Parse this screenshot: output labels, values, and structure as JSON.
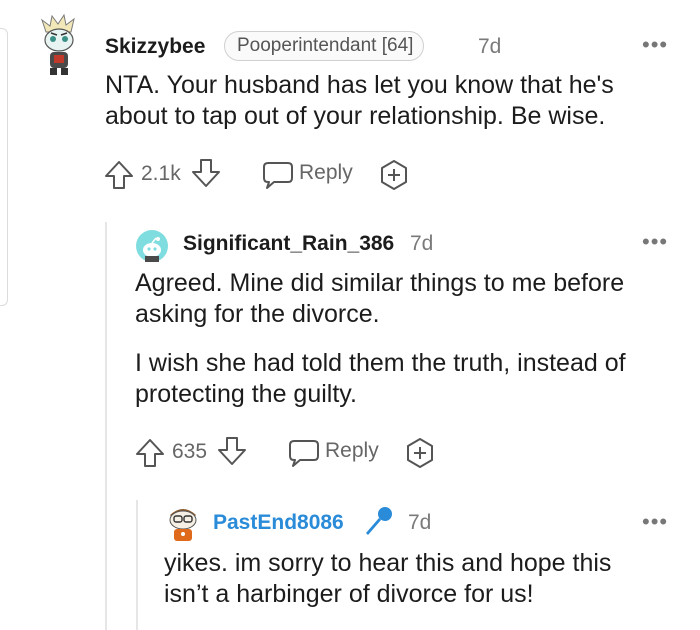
{
  "comments": [
    {
      "username": "Skizzybee",
      "flair": "Pooperintendant [64]",
      "time": "7d",
      "avatar": "snoo-avatar-skizzybee",
      "paragraphs": [
        "NTA. Your husband has let you know that he's",
        "about to tap out of your relationship. Be wise."
      ],
      "votes": "2.1k",
      "reply_label": "Reply"
    },
    {
      "username": "Significant_Rain_386",
      "time": "7d",
      "avatar": "default-snoo-avatar",
      "paragraphs": [
        "Agreed. Mine did similar things to me before",
        "asking for the divorce.",
        "I wish she had told them the truth, instead of",
        "protecting the guilty."
      ],
      "votes": "635",
      "reply_label": "Reply"
    },
    {
      "username": "PastEnd8086",
      "time": "7d",
      "avatar": "snoo-avatar-pastend",
      "op_badge_icon": "microphone-icon",
      "paragraphs": [
        "yikes. im sorry to hear this and hope this",
        "isn’t a harbinger of divorce for us!"
      ]
    }
  ],
  "colors": {
    "op_blue": "#2a8bd8",
    "text": "#1c1c1c",
    "meta": "#666666"
  }
}
